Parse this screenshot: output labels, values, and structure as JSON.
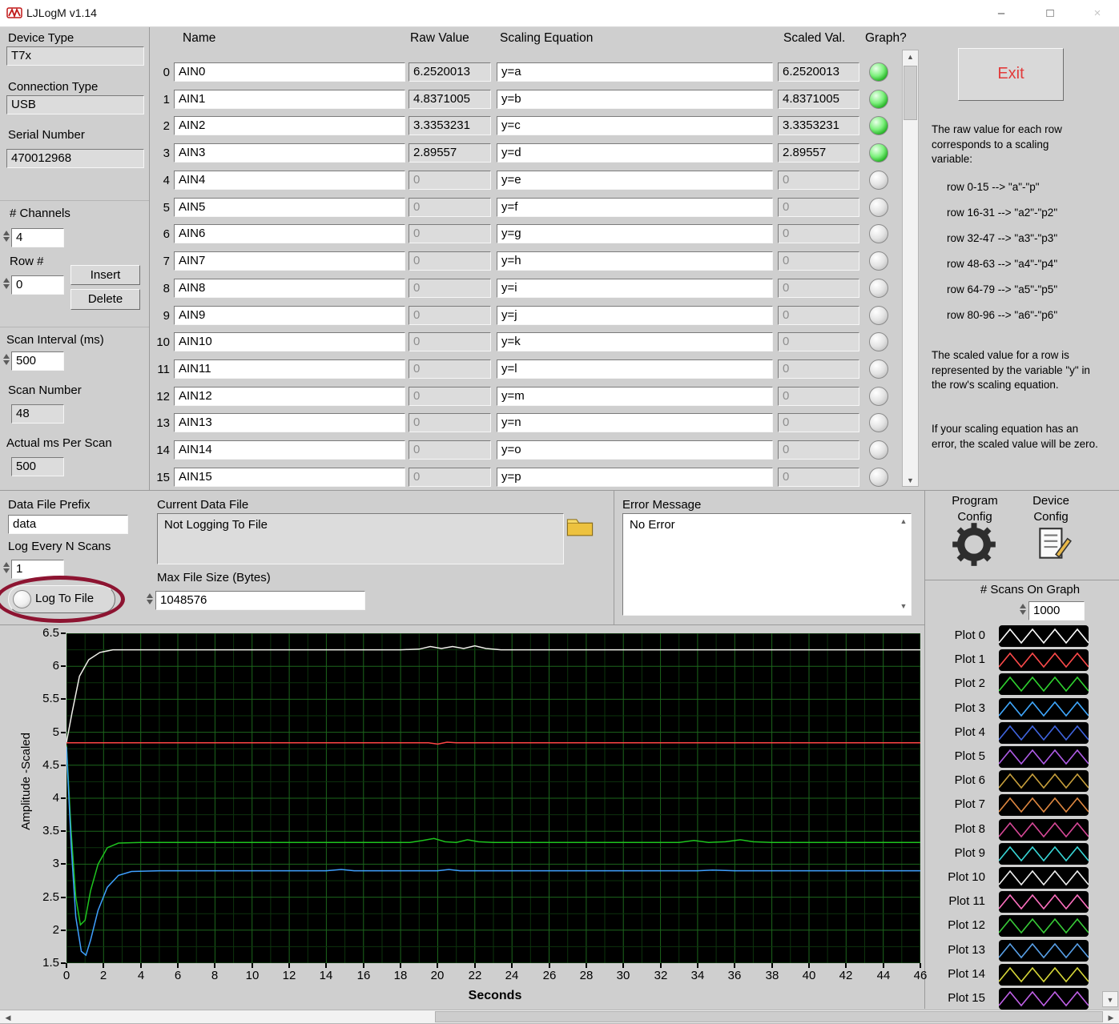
{
  "titlebar": {
    "title": "LJLogM v1.14",
    "minimize": "–",
    "maximize": "□",
    "close": "×"
  },
  "left_panel": {
    "device_type_label": "Device Type",
    "device_type_value": "T7x",
    "connection_type_label": "Connection Type",
    "connection_type_value": "USB",
    "serial_number_label": "Serial Number",
    "serial_number_value": "470012968",
    "channels_label": "# Channels",
    "channels_value": "4",
    "row_label": "Row #",
    "row_value": "0",
    "insert_label": "Insert",
    "delete_label": "Delete",
    "scan_interval_label": "Scan Interval (ms)",
    "scan_interval_value": "500",
    "scan_number_label": "Scan Number",
    "scan_number_value": "48",
    "actual_ms_label": "Actual ms Per Scan",
    "actual_ms_value": "500"
  },
  "table": {
    "headers": {
      "name": "Name",
      "raw": "Raw Value",
      "equation": "Scaling Equation",
      "scaled": "Scaled Val.",
      "graph": "Graph?"
    },
    "rows": [
      {
        "idx": "0",
        "name": "AIN0",
        "raw": "6.2520013",
        "eq": "y=a",
        "scaled": "6.2520013",
        "led": "on"
      },
      {
        "idx": "1",
        "name": "AIN1",
        "raw": "4.8371005",
        "eq": "y=b",
        "scaled": "4.8371005",
        "led": "on"
      },
      {
        "idx": "2",
        "name": "AIN2",
        "raw": "3.3353231",
        "eq": "y=c",
        "scaled": "3.3353231",
        "led": "on"
      },
      {
        "idx": "3",
        "name": "AIN3",
        "raw": "2.89557",
        "eq": "y=d",
        "scaled": "2.89557",
        "led": "on"
      },
      {
        "idx": "4",
        "name": "AIN4",
        "raw": "0",
        "eq": "y=e",
        "scaled": "0",
        "led": "off"
      },
      {
        "idx": "5",
        "name": "AIN5",
        "raw": "0",
        "eq": "y=f",
        "scaled": "0",
        "led": "off"
      },
      {
        "idx": "6",
        "name": "AIN6",
        "raw": "0",
        "eq": "y=g",
        "scaled": "0",
        "led": "off"
      },
      {
        "idx": "7",
        "name": "AIN7",
        "raw": "0",
        "eq": "y=h",
        "scaled": "0",
        "led": "off"
      },
      {
        "idx": "8",
        "name": "AIN8",
        "raw": "0",
        "eq": "y=i",
        "scaled": "0",
        "led": "off"
      },
      {
        "idx": "9",
        "name": "AIN9",
        "raw": "0",
        "eq": "y=j",
        "scaled": "0",
        "led": "off"
      },
      {
        "idx": "10",
        "name": "AIN10",
        "raw": "0",
        "eq": "y=k",
        "scaled": "0",
        "led": "off"
      },
      {
        "idx": "11",
        "name": "AIN11",
        "raw": "0",
        "eq": "y=l",
        "scaled": "0",
        "led": "off"
      },
      {
        "idx": "12",
        "name": "AIN12",
        "raw": "0",
        "eq": "y=m",
        "scaled": "0",
        "led": "off"
      },
      {
        "idx": "13",
        "name": "AIN13",
        "raw": "0",
        "eq": "y=n",
        "scaled": "0",
        "led": "off"
      },
      {
        "idx": "14",
        "name": "AIN14",
        "raw": "0",
        "eq": "y=o",
        "scaled": "0",
        "led": "off"
      },
      {
        "idx": "15",
        "name": "AIN15",
        "raw": "0",
        "eq": "y=p",
        "scaled": "0",
        "led": "off"
      }
    ]
  },
  "right_panel": {
    "exit_label": "Exit",
    "help_intro": "The raw value for each row corresponds to a scaling variable:",
    "var_map_lines": [
      "row 0-15  -->  \"a\"-\"p\"",
      "row 16-31 -->  \"a2\"-\"p2\"",
      "row 32-47 -->  \"a3\"-\"p3\"",
      "row 48-63 -->  \"a4\"-\"p4\"",
      "row 64-79 -->  \"a5\"-\"p5\"",
      "row 80-96 -->  \"a6\"-\"p6\""
    ],
    "help_scaled": "The scaled value for a row is represented by the variable  \"y\" in the row's scaling equation.",
    "help_error": "If your scaling  equation has an error, the scaled value will be zero."
  },
  "file_section": {
    "prefix_label": "Data File Prefix",
    "prefix_value": "data",
    "log_n_label": "Log Every N Scans",
    "log_n_value": "1",
    "log_to_file_label": "Log To File",
    "current_file_label": "Current Data File",
    "current_file_value": "Not Logging To File",
    "max_size_label": "Max File Size (Bytes)",
    "max_size_value": "1048576",
    "error_label": "Error Message",
    "error_value": "No Error"
  },
  "config_section": {
    "program_config_label": "Program Config",
    "device_config_label": "Device Config",
    "scans_on_graph_label": "# Scans On Graph",
    "scans_on_graph_value": "1000"
  },
  "graph": {
    "legend": [
      {
        "label": "Plot 0",
        "color": "#ffffff"
      },
      {
        "label": "Plot 1",
        "color": "#ff4a4a"
      },
      {
        "label": "Plot 2",
        "color": "#2fd42f"
      },
      {
        "label": "Plot 3",
        "color": "#3fa8ff"
      },
      {
        "label": "Plot 4",
        "color": "#3f64e0"
      },
      {
        "label": "Plot 5",
        "color": "#b05ce8"
      },
      {
        "label": "Plot 6",
        "color": "#c8a03c"
      },
      {
        "label": "Plot 7",
        "color": "#e08840"
      },
      {
        "label": "Plot 8",
        "color": "#d84898"
      },
      {
        "label": "Plot 9",
        "color": "#38d8d8"
      },
      {
        "label": "Plot 10",
        "color": "#f0f0f0"
      },
      {
        "label": "Plot 11",
        "color": "#ff70c0"
      },
      {
        "label": "Plot 12",
        "color": "#38cc38"
      },
      {
        "label": "Plot 13",
        "color": "#58a0e8"
      },
      {
        "label": "Plot 14",
        "color": "#d8d838"
      },
      {
        "label": "Plot 15",
        "color": "#c060e8"
      }
    ]
  },
  "chart_data": {
    "type": "line",
    "title": "",
    "xlabel": "Seconds",
    "ylabel": "Amplitude -Scaled",
    "xlim": [
      0,
      46
    ],
    "ylim": [
      1.5,
      6.5
    ],
    "x_tick_step": 2,
    "y_tick_step": 0.5,
    "grid": true,
    "legend_position": "right",
    "series": [
      {
        "name": "AIN0 (Plot 0)",
        "color": "#f0f0ea",
        "points": [
          [
            0,
            4.85
          ],
          [
            0.3,
            5.3
          ],
          [
            0.7,
            5.85
          ],
          [
            1.2,
            6.1
          ],
          [
            1.8,
            6.21
          ],
          [
            2.5,
            6.25
          ],
          [
            4,
            6.25
          ],
          [
            6,
            6.25
          ],
          [
            8,
            6.25
          ],
          [
            10,
            6.25
          ],
          [
            12,
            6.25
          ],
          [
            14,
            6.25
          ],
          [
            16,
            6.25
          ],
          [
            18,
            6.25
          ],
          [
            19,
            6.26
          ],
          [
            19.6,
            6.3
          ],
          [
            20.2,
            6.27
          ],
          [
            20.8,
            6.3
          ],
          [
            21.4,
            6.27
          ],
          [
            22,
            6.31
          ],
          [
            22.6,
            6.27
          ],
          [
            23.4,
            6.25
          ],
          [
            26,
            6.25
          ],
          [
            30,
            6.25
          ],
          [
            34,
            6.25
          ],
          [
            38,
            6.25
          ],
          [
            42,
            6.25
          ],
          [
            46,
            6.25
          ]
        ]
      },
      {
        "name": "AIN1 (Plot 1)",
        "color": "#ff4545",
        "points": [
          [
            0,
            4.84
          ],
          [
            4,
            4.84
          ],
          [
            8,
            4.84
          ],
          [
            12,
            4.84
          ],
          [
            16,
            4.84
          ],
          [
            19.5,
            4.84
          ],
          [
            20,
            4.82
          ],
          [
            20.5,
            4.85
          ],
          [
            21,
            4.84
          ],
          [
            24,
            4.84
          ],
          [
            28,
            4.84
          ],
          [
            32,
            4.84
          ],
          [
            36,
            4.84
          ],
          [
            40,
            4.84
          ],
          [
            44,
            4.84
          ],
          [
            46,
            4.84
          ]
        ]
      },
      {
        "name": "AIN2 (Plot 2)",
        "color": "#1ec41e",
        "points": [
          [
            0,
            4.8
          ],
          [
            0.25,
            3.5
          ],
          [
            0.5,
            2.5
          ],
          [
            0.75,
            2.08
          ],
          [
            1,
            2.15
          ],
          [
            1.3,
            2.6
          ],
          [
            1.7,
            3.0
          ],
          [
            2.2,
            3.25
          ],
          [
            2.8,
            3.32
          ],
          [
            4,
            3.33
          ],
          [
            8,
            3.33
          ],
          [
            12,
            3.33
          ],
          [
            16,
            3.33
          ],
          [
            18.5,
            3.33
          ],
          [
            19.2,
            3.36
          ],
          [
            19.8,
            3.39
          ],
          [
            20.4,
            3.34
          ],
          [
            21,
            3.33
          ],
          [
            21.6,
            3.37
          ],
          [
            22.2,
            3.34
          ],
          [
            23,
            3.33
          ],
          [
            26,
            3.33
          ],
          [
            30,
            3.33
          ],
          [
            33,
            3.33
          ],
          [
            33.8,
            3.36
          ],
          [
            34.6,
            3.33
          ],
          [
            35.5,
            3.34
          ],
          [
            36.3,
            3.37
          ],
          [
            37,
            3.34
          ],
          [
            38,
            3.33
          ],
          [
            42,
            3.33
          ],
          [
            46,
            3.33
          ]
        ]
      },
      {
        "name": "AIN3 (Plot 3)",
        "color": "#3fa0ff",
        "points": [
          [
            0,
            4.78
          ],
          [
            0.25,
            3.3
          ],
          [
            0.5,
            2.2
          ],
          [
            0.8,
            1.68
          ],
          [
            1.05,
            1.62
          ],
          [
            1.3,
            1.85
          ],
          [
            1.7,
            2.3
          ],
          [
            2.2,
            2.65
          ],
          [
            2.8,
            2.83
          ],
          [
            3.5,
            2.89
          ],
          [
            5,
            2.9
          ],
          [
            10,
            2.9
          ],
          [
            14,
            2.9
          ],
          [
            14.8,
            2.92
          ],
          [
            15.5,
            2.9
          ],
          [
            20,
            2.9
          ],
          [
            20.6,
            2.92
          ],
          [
            21.2,
            2.9
          ],
          [
            26,
            2.9
          ],
          [
            30,
            2.9
          ],
          [
            34,
            2.9
          ],
          [
            34.8,
            2.91
          ],
          [
            36,
            2.9
          ],
          [
            40,
            2.9
          ],
          [
            44,
            2.9
          ],
          [
            46,
            2.9
          ]
        ]
      }
    ]
  }
}
